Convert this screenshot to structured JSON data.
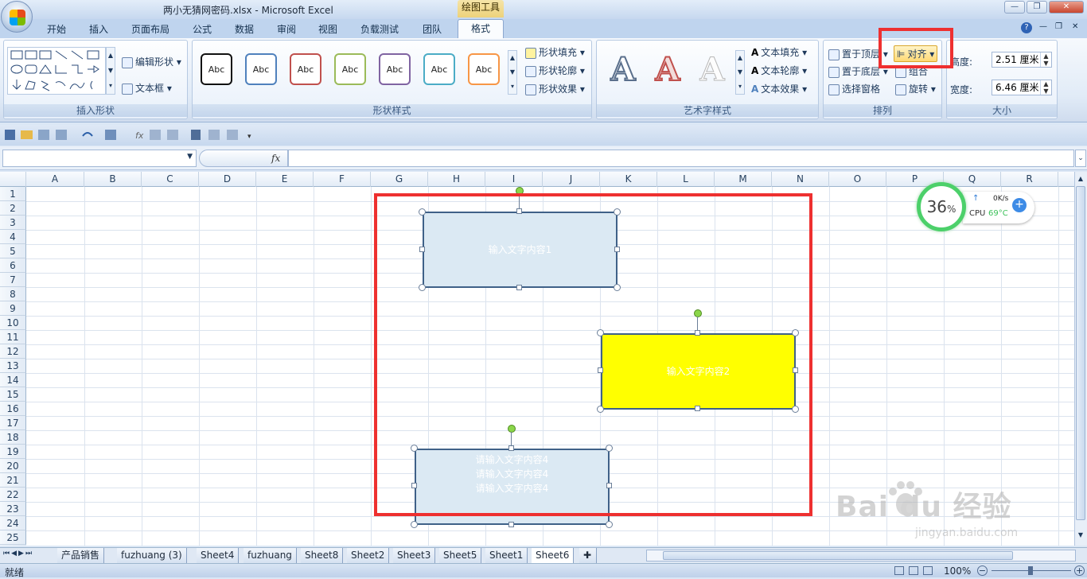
{
  "window": {
    "title": "两小无猜网密码.xlsx - Microsoft Excel",
    "context_tab": "绘图工具"
  },
  "tabs": [
    "开始",
    "插入",
    "页面布局",
    "公式",
    "数据",
    "审阅",
    "视图",
    "负载测试",
    "团队",
    "格式"
  ],
  "ribbon": {
    "insert_shapes": {
      "edit_shape": "编辑形状",
      "text_box": "文本框",
      "label": "插入形状"
    },
    "shape_styles": {
      "sample": "Abc",
      "fill": "形状填充",
      "outline": "形状轮廓",
      "effects": "形状效果",
      "label": "形状样式"
    },
    "wordart": {
      "sample": "A",
      "text_fill": "文本填充",
      "text_outline": "文本轮廓",
      "text_effects": "文本效果",
      "label": "艺术字样式"
    },
    "arrange": {
      "bring_front": "置于顶层",
      "send_back": "置于底层",
      "selection_pane": "选择窗格",
      "align": "对齐",
      "group": "组合",
      "rotate": "旋转",
      "label": "排列"
    },
    "size": {
      "height_label": "高度:",
      "height_value": "2.51 厘米",
      "width_label": "宽度:",
      "width_value": "6.46 厘米",
      "label": "大小"
    }
  },
  "formula_bar": {
    "fx": "fx"
  },
  "columns": [
    "A",
    "B",
    "C",
    "D",
    "E",
    "F",
    "G",
    "H",
    "I",
    "J",
    "K",
    "L",
    "M",
    "N",
    "O",
    "P",
    "Q",
    "R"
  ],
  "rows": [
    "1",
    "2",
    "3",
    "4",
    "5",
    "6",
    "7",
    "8",
    "9",
    "10",
    "11",
    "12",
    "13",
    "14",
    "15",
    "16",
    "17",
    "18",
    "19",
    "20",
    "21",
    "22",
    "23",
    "24",
    "25"
  ],
  "shapes": {
    "shape1": {
      "text": "输入文字内容1"
    },
    "shape2": {
      "text": "输入文字内容2"
    },
    "shape3": {
      "line1": "请输入文字内容4",
      "line2": "请输入文字内容4",
      "line3": "请输入文字内容4"
    }
  },
  "cpu_widget": {
    "percent": "36",
    "percent_sign": "%",
    "net": "0K/s",
    "cpu_label": "CPU",
    "temp": "69°C"
  },
  "sheets": [
    "产品销售",
    "fuzhuang (3)",
    "Sheet4",
    "fuzhuang",
    "Sheet8",
    "Sheet2",
    "Sheet3",
    "Sheet5",
    "Sheet1",
    "Sheet6"
  ],
  "status": {
    "ready": "就绪",
    "zoom": "100%"
  },
  "watermark": {
    "brand": "Bai du 经验",
    "url": "jingyan.baidu.com"
  },
  "colors": {
    "accent_red": "#ee3030",
    "shape_fill": "#dbe9f3",
    "shape_yellow": "#ffff00"
  }
}
